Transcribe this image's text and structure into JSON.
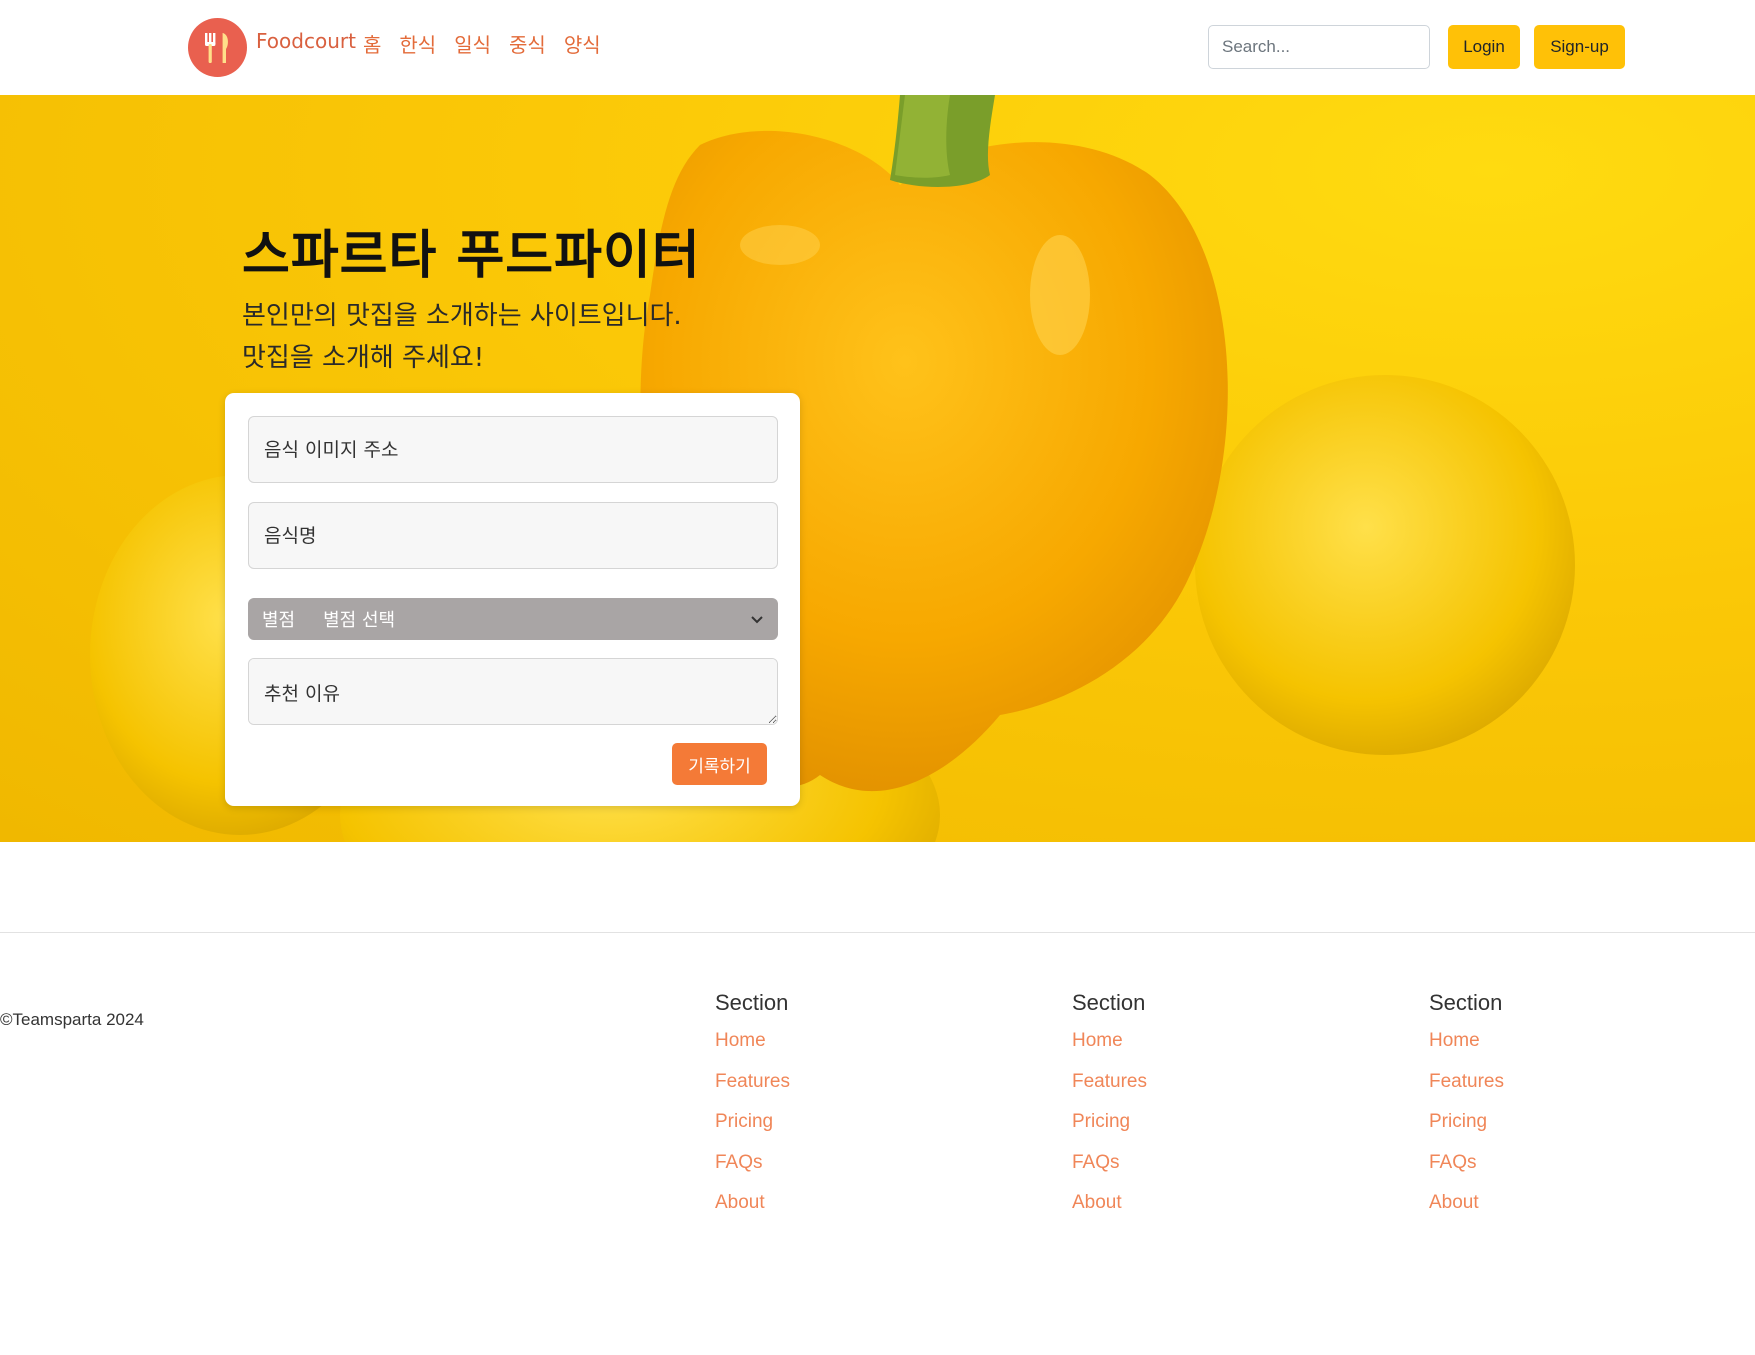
{
  "navbar": {
    "brand": "Foodcourt",
    "links": [
      "홈",
      "한식",
      "일식",
      "중식",
      "양식"
    ],
    "search_placeholder": "Search...",
    "login_label": "Login",
    "signup_label": "Sign-up",
    "logo_icon": "fork-knife-icon",
    "logo_color": "#e9604f"
  },
  "hero": {
    "title": "스파르타 푸드파이터",
    "subtitle_line1": "본인만의 맛집을 소개하는 사이트입니다.",
    "subtitle_line2": "맛집을 소개해 주세요!",
    "background_color": "#fbc807"
  },
  "form": {
    "image_url_placeholder": "음식 이미지 주소",
    "food_name_placeholder": "음식명",
    "rating_label": "별점",
    "rating_selected": "별점 선택",
    "reason_placeholder": "추천 이유",
    "submit_label": "기록하기",
    "submit_color": "#f47a37"
  },
  "footer": {
    "copyright": "©Teamsparta 2024",
    "sections": [
      {
        "title": "Section",
        "links": [
          "Home",
          "Features",
          "Pricing",
          "FAQs",
          "About"
        ]
      },
      {
        "title": "Section",
        "links": [
          "Home",
          "Features",
          "Pricing",
          "FAQs",
          "About"
        ]
      },
      {
        "title": "Section",
        "links": [
          "Home",
          "Features",
          "Pricing",
          "FAQs",
          "About"
        ]
      }
    ],
    "link_color": "#f08658"
  }
}
